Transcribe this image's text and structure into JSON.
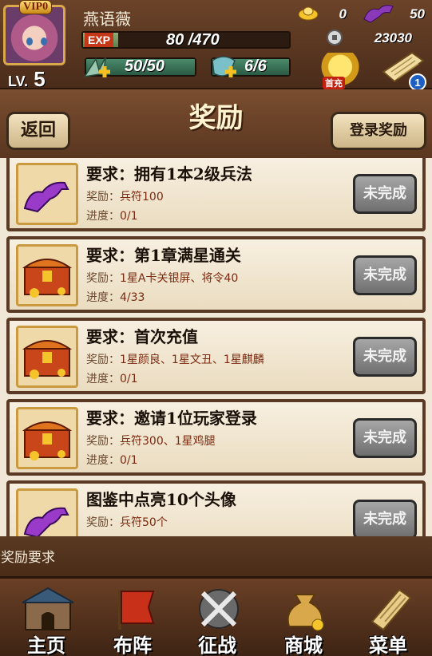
{
  "player": {
    "vip": "VIP0",
    "name": "燕语薇",
    "level_prefix": "LV.",
    "level": "5",
    "exp_label": "EXP",
    "exp_text": "80 /470",
    "exp_progress": 0.17,
    "stamina_text": "50/50",
    "energy_text": "6/6"
  },
  "resources": {
    "gold": "0",
    "tokens": "50",
    "silver": "23030"
  },
  "header": {
    "first_charge_label": "首充",
    "notification_count": "1"
  },
  "titlebar": {
    "title": "奖励",
    "back_label": "返回",
    "login_reward_label": "登录奖励"
  },
  "tasks": [
    {
      "icon": "purple-horse-icon",
      "title": "要求：拥有1本2级兵法",
      "reward_key": "奖励：",
      "reward": "兵符100",
      "progress_key": "进度：",
      "progress": "0/1",
      "button": "未完成"
    },
    {
      "icon": "treasure-chest-icon",
      "title": "要求：第1章满星通关",
      "reward_key": "奖励：",
      "reward": "1星A卡关银屏、将令40",
      "progress_key": "进度：",
      "progress": "4/33",
      "button": "未完成"
    },
    {
      "icon": "treasure-chest-icon",
      "title": "要求：首次充值",
      "reward_key": "奖励：",
      "reward": "1星颜良、1星文丑、1星麒麟",
      "progress_key": "进度：",
      "progress": "0/1",
      "button": "未完成"
    },
    {
      "icon": "treasure-chest-icon",
      "title": "要求：邀请1位玩家登录",
      "reward_key": "奖励：",
      "reward": "兵符300、1星鸡腿",
      "progress_key": "进度：",
      "progress": "0/1",
      "button": "未完成"
    },
    {
      "icon": "purple-horse-icon",
      "title": "图鉴中点亮10个头像",
      "reward_key": "奖励：",
      "reward": "兵符50个",
      "progress_key": "",
      "progress": "",
      "button": "未完成"
    }
  ],
  "hint": "阶奖励要求",
  "nav": [
    {
      "label": "主页",
      "icon": "city-gate-icon"
    },
    {
      "label": "布阵",
      "icon": "war-flag-icon"
    },
    {
      "label": "征战",
      "icon": "crossed-swords-icon"
    },
    {
      "label": "商城",
      "icon": "money-bag-icon"
    },
    {
      "label": "菜单",
      "icon": "scroll-menu-icon"
    }
  ],
  "colors": {
    "header_bg": "#5a3620",
    "exp_label_bg": "#c43718",
    "button_disabled": "#8a8a8a",
    "notification": "#1e5fc4"
  }
}
